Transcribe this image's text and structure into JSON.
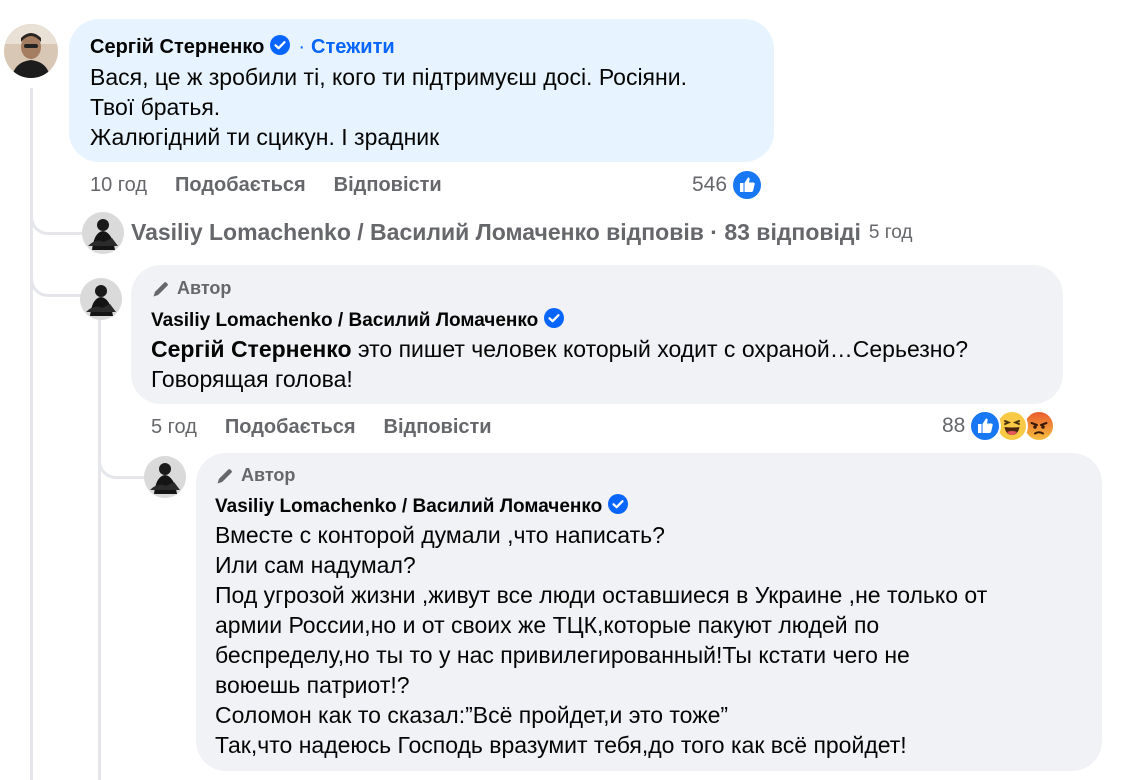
{
  "comment1": {
    "author": "Сергій Стерненко",
    "follow": "Стежити",
    "lines": [
      "Вася, це ж зробили ті, кого ти підтримуєш досі. Росіяни.",
      "Твої братья.",
      "Жалюгідний ти сцикун. І зрадник"
    ],
    "time": "10 год",
    "like_label": "Подобається",
    "reply_label": "Відповісти",
    "reaction_count": "546"
  },
  "replies_link": {
    "text": "Vasiliy Lomachenko / Василий Ломаченко відповів · 83 відповіді",
    "time": "5 год"
  },
  "reply1": {
    "author_badge": "Автор",
    "author": "Vasiliy Lomachenko / Василий Ломаченко",
    "mention": "Сергій Стерненко",
    "line1": "это пишет человек который ходит с охраной…Серьезно?",
    "line2": "Говорящая голова!",
    "time": "5 год",
    "like_label": "Подобається",
    "reply_label": "Відповісти",
    "reaction_count": "88"
  },
  "reply2": {
    "author_badge": "Автор",
    "author": "Vasiliy Lomachenko / Василий Ломаченко",
    "lines": [
      "Вместе с конторой думали ,что написать?",
      "Или сам надумал?",
      "Под угрозой жизни ,живут все люди оставшиеся в Украине ,не только от",
      "армии России,но и от своих же ТЦК,которые пакуют людей по",
      "беспределу,но ты то у нас привилегированный!Ты кстати чего не",
      "воюешь патриот!?",
      "Соломон как то сказал:”Всё пройдет,и это тоже”",
      "Так,что надеюсь Господь вразумит тебя,до того как всё пройдет!"
    ]
  },
  "colors": {
    "verified_blue": "#0866ff",
    "bubble_grey": "#f0f2f5",
    "bubble_highlight": "#e7f3ff",
    "secondary_text": "#65676b"
  },
  "icons": [
    "verified-badge-icon",
    "pencil-icon",
    "like-reaction-icon",
    "haha-reaction-icon",
    "angry-reaction-icon"
  ]
}
